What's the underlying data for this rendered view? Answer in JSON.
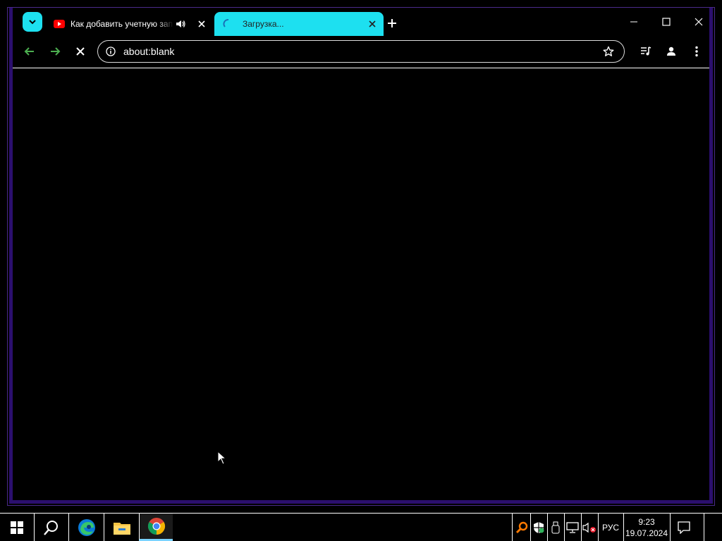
{
  "browser": {
    "tabs": [
      {
        "title": "Как добавить учетную зап",
        "favicon": "youtube-icon",
        "audio": true
      },
      {
        "title": "Загрузка...",
        "favicon": "loading-spinner-icon",
        "active": true
      }
    ],
    "address_bar": {
      "url": "about:blank"
    },
    "colors": {
      "accent": "#1de0f0",
      "frame": "#2b0f6e",
      "nav_green": "#4caf50"
    }
  },
  "taskbar": {
    "apps": [
      "start-icon",
      "search-icon",
      "edge-icon",
      "file-explorer-icon",
      "chrome-icon"
    ],
    "tray": {
      "language": "РУС",
      "time": "9:23",
      "date": "19.07.2024"
    }
  }
}
